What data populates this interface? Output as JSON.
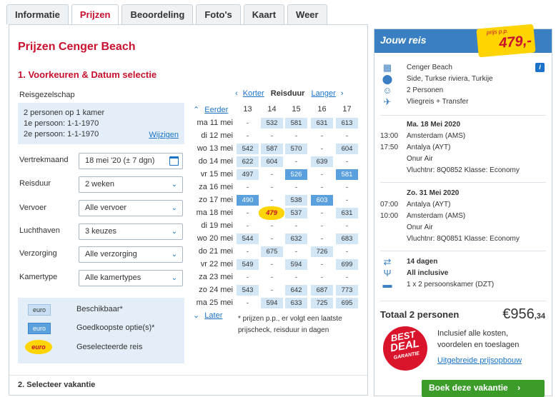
{
  "tabs": [
    "Informatie",
    "Prijzen",
    "Beoordeling",
    "Foto's",
    "Kaart",
    "Weer"
  ],
  "title": "Prijzen Cenger Beach",
  "section1": "1. Voorkeuren & Datum selectie",
  "section2": "2. Selecteer vakantie",
  "party": {
    "label": "Reisgezelschap",
    "line1": "2 personen op 1 kamer",
    "line2": "1e persoon: 1-1-1970",
    "line3": "2e persoon: 1-1-1970",
    "edit": "Wijzigen"
  },
  "filters": [
    {
      "label": "Vertrekmaand",
      "value": "18 mei '20 (± 7 dgn)"
    },
    {
      "label": "Reisduur",
      "value": "2 weken"
    },
    {
      "label": "Vervoer",
      "value": "Alle vervoer"
    },
    {
      "label": "Luchthaven",
      "value": "3 keuzes"
    },
    {
      "label": "Verzorging",
      "value": "Alle verzorging"
    },
    {
      "label": "Kamertype",
      "value": "Alle kamertypes"
    }
  ],
  "legend": [
    {
      "chip": "euro",
      "text": "Beschikbaar*"
    },
    {
      "chip": "euro",
      "text": "Goedkoopste optie(s)*"
    },
    {
      "chip": "euro",
      "text": "Geselecteerde reis"
    }
  ],
  "grid": {
    "shorter": "Korter",
    "duration": "Reisduur",
    "longer": "Langer",
    "earlier": "Eerder",
    "later": "Later",
    "columns": [
      "13",
      "14",
      "15",
      "16",
      "17"
    ],
    "rows": [
      {
        "date": "ma 11 mei",
        "cells": [
          "-",
          "532",
          "581",
          "631",
          "613"
        ],
        "types": [
          "n",
          "p",
          "p",
          "p",
          "p"
        ]
      },
      {
        "date": "di 12 mei",
        "cells": [
          "-",
          "-",
          "-",
          "-",
          "-"
        ],
        "types": [
          "n",
          "n",
          "n",
          "n",
          "n"
        ]
      },
      {
        "date": "wo 13 mei",
        "cells": [
          "542",
          "587",
          "570",
          "-",
          "604"
        ],
        "types": [
          "p",
          "p",
          "p",
          "n",
          "p"
        ]
      },
      {
        "date": "do 14 mei",
        "cells": [
          "622",
          "604",
          "-",
          "639",
          "-"
        ],
        "types": [
          "p",
          "p",
          "n",
          "p",
          "n"
        ]
      },
      {
        "date": "vr 15 mei",
        "cells": [
          "497",
          "-",
          "526",
          "-",
          "581"
        ],
        "types": [
          "p",
          "n",
          "b",
          "n",
          "b"
        ]
      },
      {
        "date": "za 16 mei",
        "cells": [
          "-",
          "-",
          "-",
          "-",
          "-"
        ],
        "types": [
          "n",
          "n",
          "n",
          "n",
          "n"
        ]
      },
      {
        "date": "zo 17 mei",
        "cells": [
          "490",
          "-",
          "538",
          "603",
          "-"
        ],
        "types": [
          "b",
          "n",
          "p",
          "b",
          "n"
        ]
      },
      {
        "date": "ma 18 mei",
        "cells": [
          "-",
          "479",
          "537",
          "-",
          "631"
        ],
        "types": [
          "n",
          "y",
          "p",
          "n",
          "p"
        ]
      },
      {
        "date": "di 19 mei",
        "cells": [
          "-",
          "-",
          "-",
          "-",
          "-"
        ],
        "types": [
          "n",
          "n",
          "n",
          "n",
          "n"
        ]
      },
      {
        "date": "wo 20 mei",
        "cells": [
          "544",
          "-",
          "632",
          "-",
          "683"
        ],
        "types": [
          "p",
          "n",
          "p",
          "n",
          "p"
        ]
      },
      {
        "date": "do 21 mei",
        "cells": [
          "-",
          "675",
          "-",
          "726",
          "-"
        ],
        "types": [
          "n",
          "p",
          "n",
          "p",
          "n"
        ]
      },
      {
        "date": "vr 22 mei",
        "cells": [
          "549",
          "-",
          "594",
          "-",
          "699"
        ],
        "types": [
          "p",
          "n",
          "p",
          "n",
          "p"
        ]
      },
      {
        "date": "za 23 mei",
        "cells": [
          "-",
          "-",
          "-",
          "-",
          "-"
        ],
        "types": [
          "n",
          "n",
          "n",
          "n",
          "n"
        ]
      },
      {
        "date": "zo 24 mei",
        "cells": [
          "543",
          "-",
          "642",
          "687",
          "773"
        ],
        "types": [
          "p",
          "n",
          "p",
          "p",
          "p"
        ]
      },
      {
        "date": "ma 25 mei",
        "cells": [
          "-",
          "594",
          "633",
          "725",
          "695"
        ],
        "types": [
          "n",
          "p",
          "p",
          "p",
          "p"
        ]
      }
    ],
    "note": "* prijzen p.p., er volgt een laatste prijscheck, reisduur in dagen"
  },
  "trip": {
    "header": "Jouw reis",
    "pp_label": "prijs p.p.",
    "pp_price": "479,-",
    "hotel": "Cenger Beach",
    "location": "Side, Turkse riviera, Turkije",
    "persons": "2 Personen",
    "transport": "Vliegreis + Transfer",
    "out_date": "Ma. 18 Mei 2020",
    "out_t1": "13:00",
    "out_a1": "Amsterdam (AMS)",
    "out_t2": "17:50",
    "out_a2": "Antalya (AYT)",
    "out_airline": "Onur Air",
    "out_flight": "Vluchtnr: 8Q0852 Klasse: Economy",
    "ret_date": "Zo. 31 Mei 2020",
    "ret_t1": "07:00",
    "ret_a1": "Antalya (AYT)",
    "ret_t2": "10:00",
    "ret_a2": "Amsterdam (AMS)",
    "ret_airline": "Onur Air",
    "ret_flight": "Vluchtnr: 8Q0851 Klasse: Economy",
    "days": "14 dagen",
    "board": "All inclusive",
    "room": "1 x 2 persoonskamer (DZT)",
    "total_label": "Totaal 2 personen",
    "total_main": "€956",
    "total_cents": ",34",
    "deal1": "BEST",
    "deal2": "DEAL",
    "deal3": "GARANTIE",
    "incl1": "Inclusief alle kosten,",
    "incl2": "voordelen en toeslagen",
    "breakdown": "Uitgebreide prijsopbouw",
    "book": "Boek deze vakantie"
  }
}
